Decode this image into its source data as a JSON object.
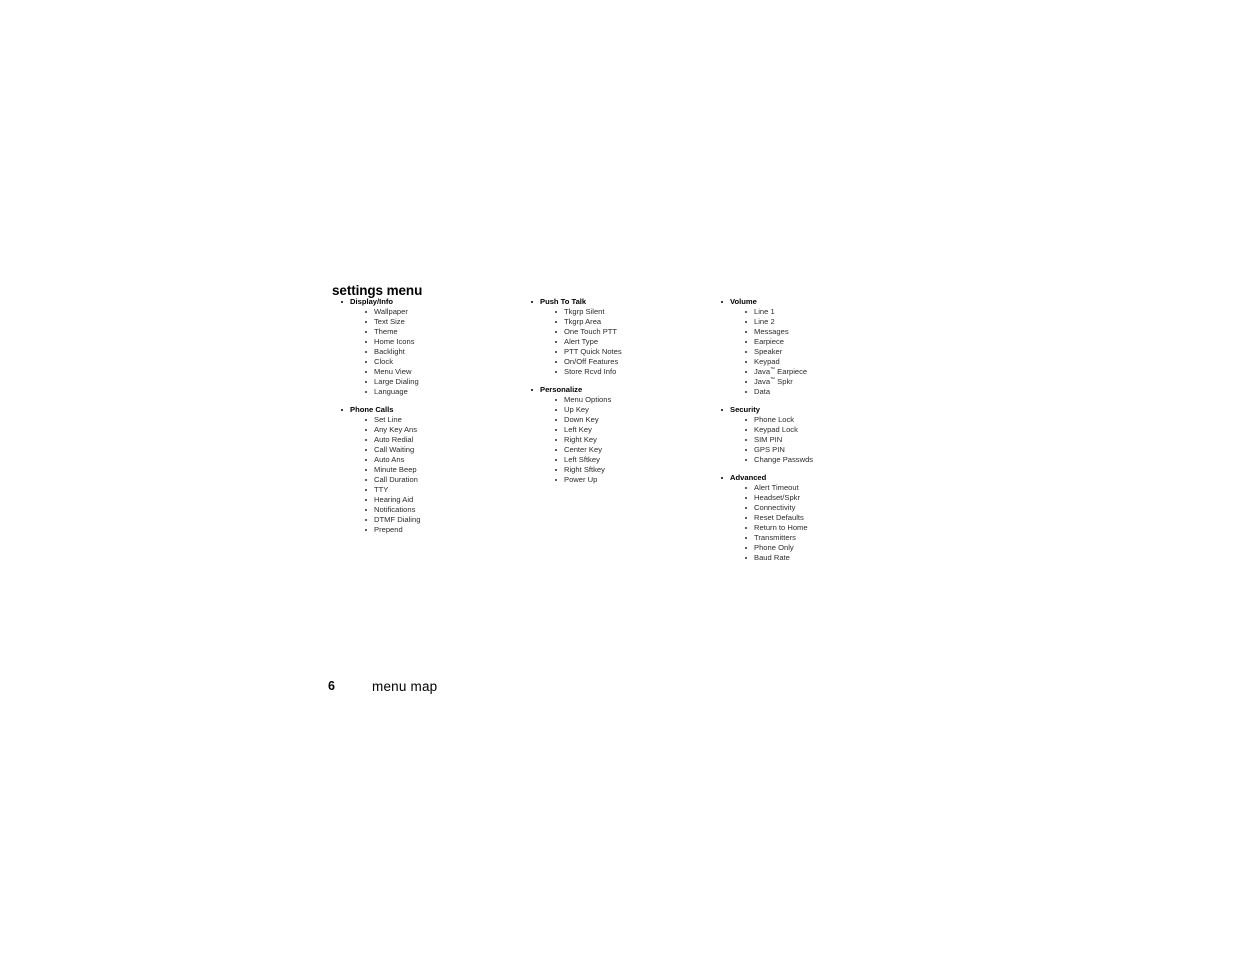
{
  "page": {
    "heading": "settings menu",
    "footer": {
      "page_number": "6",
      "title": "menu map"
    }
  },
  "columns": [
    {
      "name": "column-1",
      "groups": [
        {
          "label": "Display/Info",
          "items": [
            "Wallpaper",
            "Text Size",
            "Theme",
            "Home Icons",
            "Backlight",
            "Clock",
            "Menu View",
            "Large Dialing",
            "Language"
          ]
        },
        {
          "label": "Phone Calls",
          "items": [
            "Set Line",
            "Any Key Ans",
            "Auto Redial",
            "Call Waiting",
            "Auto Ans",
            "Minute Beep",
            "Call Duration",
            "TTY",
            "Hearing Aid",
            "Notifications",
            "DTMF Dialing",
            "Prepend"
          ]
        }
      ]
    },
    {
      "name": "column-2",
      "groups": [
        {
          "label": "Push To Talk",
          "items": [
            "Tkgrp Silent",
            "Tkgrp Area",
            "One Touch PTT",
            "Alert Type",
            "PTT Quick Notes",
            "On/Off Features",
            "Store Rcvd Info"
          ]
        },
        {
          "label": "Personalize",
          "items": [
            "Menu Options",
            "Up Key",
            "Down Key",
            "Left Key",
            "Right Key",
            "Center Key",
            "Left Sftkey",
            "Right Sftkey",
            "Power Up"
          ]
        }
      ]
    },
    {
      "name": "column-3",
      "groups": [
        {
          "label": "Volume",
          "items": [
            "Line 1",
            "Line 2",
            "Messages",
            "Earpiece",
            "Speaker",
            "Keypad",
            "Java™ Earpiece",
            "Java™ Spkr",
            "Data"
          ]
        },
        {
          "label": "Security",
          "items": [
            "Phone Lock",
            "Keypad Lock",
            "SIM PIN",
            "GPS PIN",
            "Change Passwds"
          ]
        },
        {
          "label": "Advanced",
          "items": [
            "Alert Timeout",
            "Headset/Spkr",
            "Connectivity",
            "Reset Defaults",
            "Return to Home",
            "Transmitters",
            "Phone Only",
            "Baud Rate"
          ]
        }
      ]
    }
  ]
}
